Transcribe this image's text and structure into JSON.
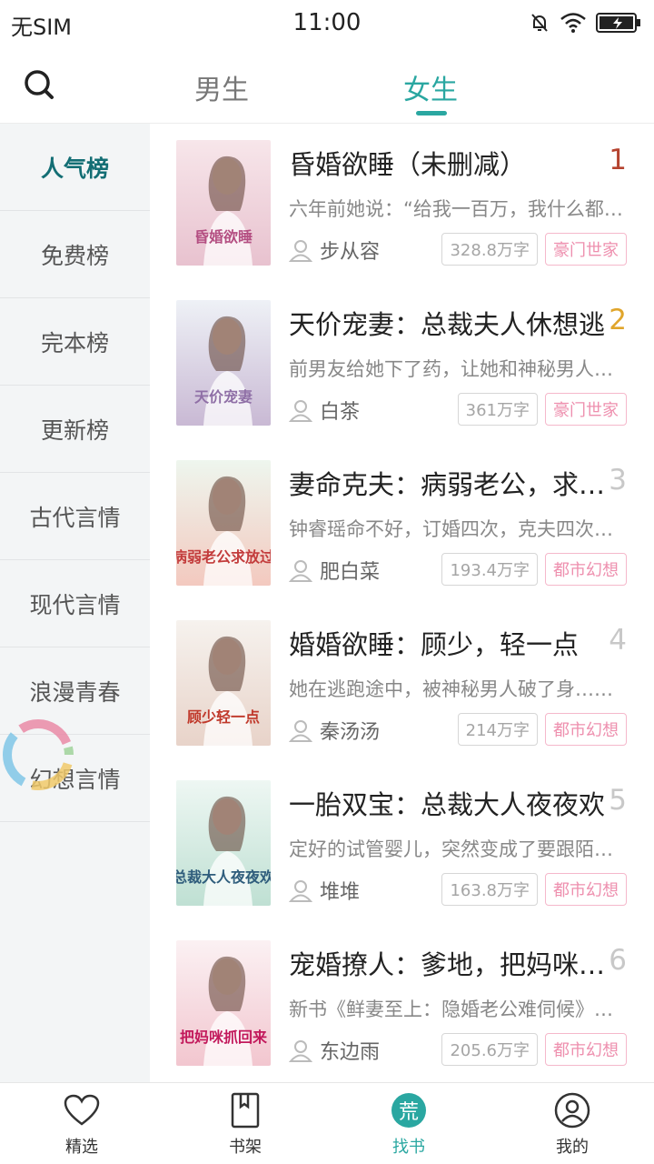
{
  "status_bar": {
    "carrier": "无SIM",
    "time": "11:00"
  },
  "header": {
    "tabs": [
      {
        "label": "男生",
        "active": false
      },
      {
        "label": "女生",
        "active": true
      }
    ],
    "accent": "#2aa7a1"
  },
  "sidebar": {
    "items": [
      {
        "label": "人气榜",
        "active": true
      },
      {
        "label": "免费榜"
      },
      {
        "label": "完本榜"
      },
      {
        "label": "更新榜"
      },
      {
        "label": "古代言情"
      },
      {
        "label": "现代言情"
      },
      {
        "label": "浪漫青春"
      },
      {
        "label": "幻想言情"
      }
    ]
  },
  "books": [
    {
      "title": "昏婚欲睡（未删减）",
      "rank": "1",
      "rank_color": "#b5432f",
      "desc": "六年前她说：“给我一百万，我什么都愿意”",
      "author": "步从容",
      "words": "328.8万字",
      "category": "豪门世家",
      "cover_text": "昏婚欲睡",
      "cover_colors": [
        "#f7e6ea",
        "#e8c2cf",
        "#b44f82"
      ]
    },
    {
      "title": "天价宠妻：总裁夫人休想逃",
      "rank": "2",
      "rank_color": "#e0a52b",
      "desc": "前男友给她下了药，让她和神秘男人一夜纠缠",
      "author": "白茶",
      "words": "361万字",
      "category": "豪门世家",
      "cover_text": "天价宠妻",
      "cover_colors": [
        "#eef1f6",
        "#c9b9d4",
        "#8f6fa6"
      ]
    },
    {
      "title": "妻命克夫：病弱老公，求放过",
      "rank": "3",
      "rank_color": "#c8c8c8",
      "desc": "钟睿瑶命不好，订婚四次，克夫四次……",
      "author": "肥白菜",
      "words": "193.4万字",
      "category": "都市幻想",
      "cover_text": "病弱老公求放过",
      "cover_colors": [
        "#eef6ee",
        "#f3c9bf",
        "#c33c3c"
      ]
    },
    {
      "title": "婚婚欲睡：顾少，轻一点",
      "rank": "4",
      "rank_color": "#c8c8c8",
      "desc": "她在逃跑途中，被神秘男人破了身……",
      "author": "秦汤汤",
      "words": "214万字",
      "category": "都市幻想",
      "cover_text": "顾少轻一点",
      "cover_colors": [
        "#f6f2ee",
        "#e8d3c9",
        "#c0392b"
      ]
    },
    {
      "title": "一胎双宝：总裁大人夜夜欢",
      "rank": "5",
      "rank_color": "#c8c8c8",
      "desc": "定好的试管婴儿，突然变成了要跟陌生男人……",
      "author": "堆堆",
      "words": "163.8万字",
      "category": "都市幻想",
      "cover_text": "总裁大人夜夜欢",
      "cover_colors": [
        "#eef7f3",
        "#bfe0d3",
        "#2f5d7c"
      ]
    },
    {
      "title": "宠婚撩人：爹地，把妈咪抓回来",
      "rank": "6",
      "rank_color": "#c8c8c8",
      "desc": "新书《鲜妻至上：隐婚老公难伺候》已发布",
      "author": "东边雨",
      "words": "205.6万字",
      "category": "都市幻想",
      "cover_text": "把妈咪抓回来",
      "cover_colors": [
        "#fbf1f3",
        "#f2c6cf",
        "#c2185b"
      ]
    }
  ],
  "bottom_nav": [
    {
      "label": "精选",
      "icon": "heart-icon",
      "active": false
    },
    {
      "label": "书架",
      "icon": "bookmark-book-icon",
      "active": false
    },
    {
      "label": "找书",
      "icon": "find-book-icon",
      "icon_text": "荒",
      "active": true
    },
    {
      "label": "我的",
      "icon": "profile-icon",
      "active": false
    }
  ]
}
